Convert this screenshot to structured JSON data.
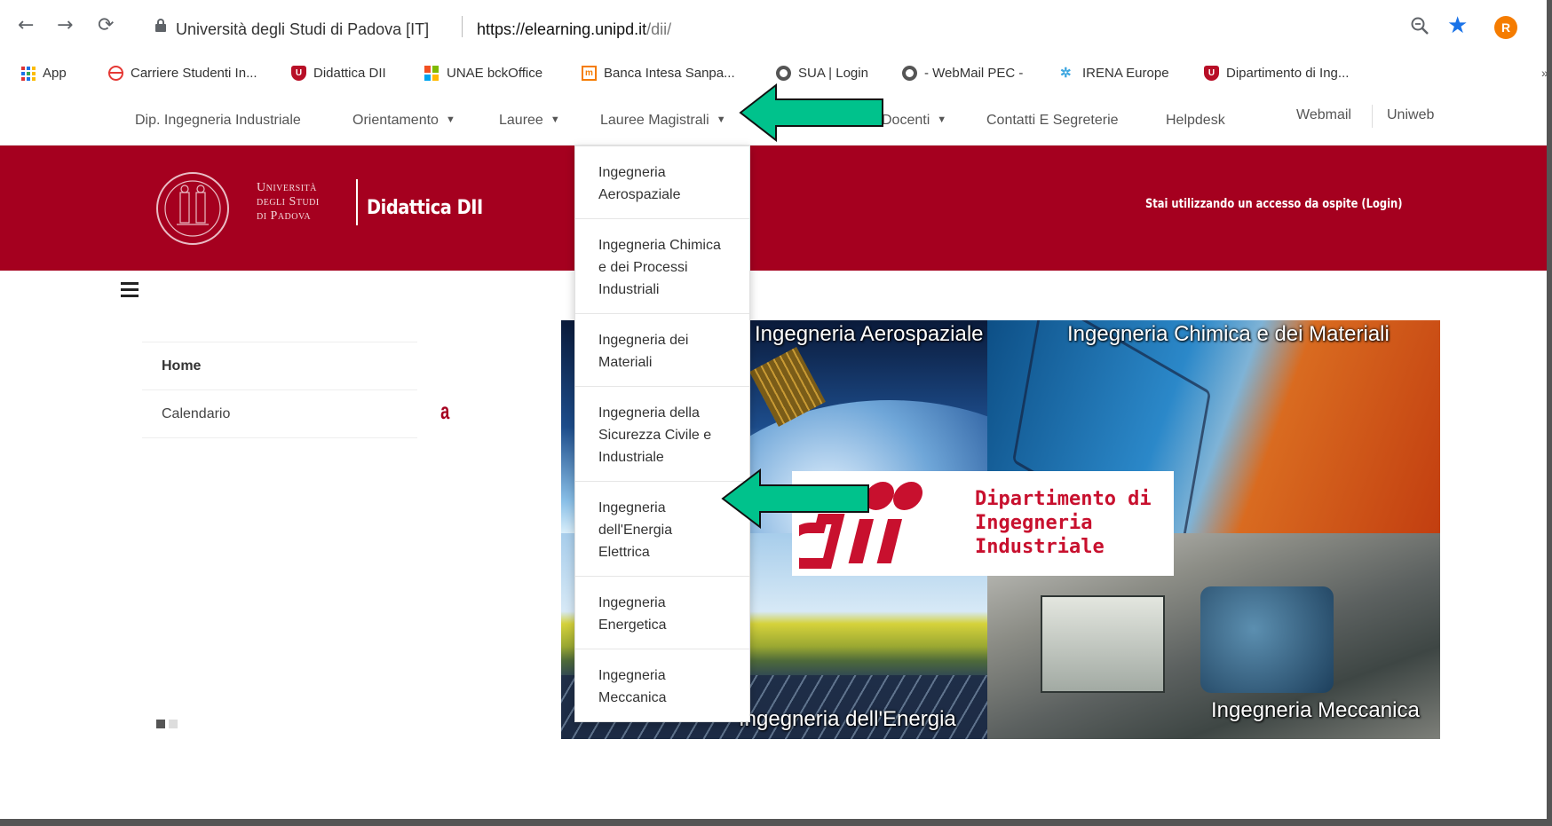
{
  "browser": {
    "site_name": "Università degli Studi di Padova [IT]",
    "url_host": "https://elearning.unipd.it",
    "url_path": "/dii/",
    "avatar_letter": "R",
    "icons": [
      "back-icon",
      "forward-icon",
      "reload-icon",
      "lock-icon",
      "zoom-icon",
      "star-icon",
      "menu-icon"
    ]
  },
  "bookmarks": [
    {
      "label": "App",
      "icon": "apps-grid-icon"
    },
    {
      "label": "Carriere Studenti In...",
      "icon": "globe-icon"
    },
    {
      "label": "Didattica DII",
      "icon": "unipd-shield-icon"
    },
    {
      "label": "UNAE bckOffice",
      "icon": "microsoft-icon"
    },
    {
      "label": "Banca Intesa Sanpa...",
      "icon": "bank-icon"
    },
    {
      "label": "SUA | Login",
      "icon": "sphere-icon"
    },
    {
      "label": "- WebMail PEC -",
      "icon": "sphere-icon"
    },
    {
      "label": "IRENA Europe",
      "icon": "irena-icon"
    },
    {
      "label": "Dipartimento di Ing...",
      "icon": "unipd-shield-icon"
    }
  ],
  "bookmarks_more": "»",
  "nav": {
    "items": [
      {
        "label": "Dip. Ingegneria Industriale"
      },
      {
        "label": "Orientamento"
      },
      {
        "label": "Lauree"
      },
      {
        "label": "Lauree Magistrali"
      },
      {
        "label": "Docenti"
      },
      {
        "label": "Contatti E Segreterie"
      },
      {
        "label": "Helpdesk"
      },
      {
        "label": "Webmail"
      },
      {
        "label": "Uniweb"
      }
    ]
  },
  "banner": {
    "univ_line1": "Università",
    "univ_line2": "degli Studi",
    "univ_line3": "di Padova",
    "brand_title": "Didattica DII",
    "guest_login": "Stai utilizzando un accesso da ospite (Login)",
    "color": "#a5001f"
  },
  "dropdown": {
    "items": [
      {
        "label": "Ingegneria Aerospaziale"
      },
      {
        "label": "Ingegneria Chimica e dei Processi Industriali"
      },
      {
        "label": "Ingegneria dei Materiali"
      },
      {
        "label": "Ingegneria della Sicurezza Civile e Industriale"
      },
      {
        "label": "Ingegneria dell'Energia Elettrica"
      },
      {
        "label": "Ingegneria Energetica"
      },
      {
        "label": "Ingegneria Meccanica"
      }
    ]
  },
  "sidemenu": {
    "items": [
      {
        "label": "Home"
      },
      {
        "label": "Calendario"
      }
    ],
    "partial_heading": "a"
  },
  "collage": {
    "labels": {
      "aero": "Ingegneria Aerospaziale",
      "chem": "Ingegneria Chimica e dei Materiali",
      "energy": "Ingegneria dell'Energia",
      "mech": "Ingegneria Meccanica"
    },
    "dept_line1": "Dipartimento di",
    "dept_line2": "Ingegneria",
    "dept_line3": "Industriale",
    "dept_color": "#c8102e"
  },
  "annotations": {
    "arrow_color": "#00c28c"
  }
}
